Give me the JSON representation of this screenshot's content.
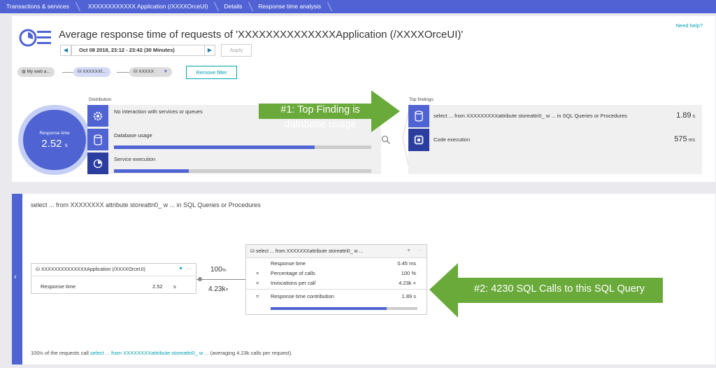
{
  "breadcrumb": [
    "Transactions & services",
    "XXXXXXXXXXXX Application (/XXXXOrceUI)",
    "Details",
    "Response time analysis"
  ],
  "header": {
    "title": "Average response time of requests of 'XXXXXXXXXXXXXXApplication (/XXXXOrceUI)'",
    "need_help": "Need help?",
    "timeframe": "Oct 08 2018, 23:12 - 23:42 (30 Minutes)",
    "apply_label": "Apply"
  },
  "filters": {
    "chip1": "My web a...",
    "chip2": "XXXXXXf...",
    "chip3": "XXXXX",
    "remove_filter": "Remove filter"
  },
  "response_time": {
    "label": "Response time",
    "value": "2.52",
    "unit": "s"
  },
  "distribution": {
    "title": "Distribution",
    "items": [
      {
        "label": "No interaction with services or queues",
        "fraction": null
      },
      {
        "label": "Database usage",
        "fraction": 0.78
      },
      {
        "label": "Service execution",
        "fraction": 0.29
      }
    ]
  },
  "top_findings": {
    "title": "Top findings",
    "items": [
      {
        "label": "select ... from XXXXXXXXXattribute storeattri0_ w ... in SQL Queries or Procedures",
        "value": "1.89",
        "unit": "s"
      },
      {
        "label": "Code execution",
        "value": "575",
        "unit": "ms"
      }
    ]
  },
  "callout1": {
    "line1": "#1: Top Finding is",
    "line2": "database usage",
    "color": "#6aaa3a"
  },
  "callout2": {
    "text": "#2: 4230 SQL Calls to this SQL Query",
    "color": "#6aaa3a"
  },
  "detail": {
    "heading": "select ... from XXXXXXXX attribute storeattri0_ w ... in SQL Queries or Procedures",
    "source_box": {
      "title": "XXXXXXXXXXXXXXApplication (/XXXXOrceUI)",
      "row_label": "Response time",
      "row_value": "2.52",
      "row_unit": "s"
    },
    "percent": "100",
    "percent_unit": "%",
    "calls": "4.23k",
    "calls_unit": "×",
    "target_box": {
      "title": "select ... from XXXXXXXattribute storeattri0_ w ...",
      "rows": [
        {
          "sym": "",
          "label": "Response time",
          "value": "0.45 ms"
        },
        {
          "sym": "×",
          "label": "Percentage of calls",
          "value": "100 %"
        },
        {
          "sym": "×",
          "label": "Invocations per call",
          "value": "4.23k ×"
        },
        {
          "sym": "=",
          "label": "Response time contribution",
          "value": "1.89 s"
        }
      ],
      "contribution_fraction": 0.79
    },
    "footer": {
      "pct": "100",
      "pct_unit": "%",
      "pre": " of the requests call ",
      "link": "select ... from XXXXXXXXattribute storeattri0_ w ...",
      "post": " (averaging 4.23k calls per request)."
    }
  }
}
